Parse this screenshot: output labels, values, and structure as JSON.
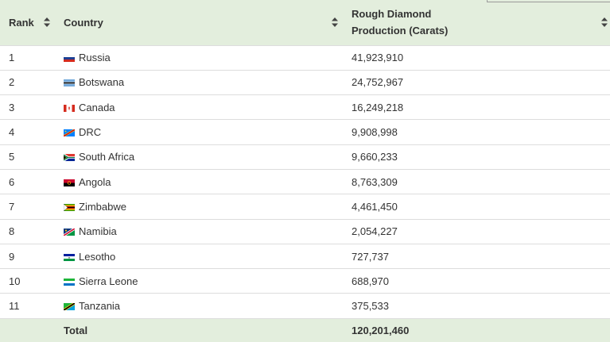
{
  "table": {
    "headers": {
      "rank": "Rank",
      "country": "Country",
      "production_line1": "Rough Diamond",
      "production_line2": "Production (Carats)"
    },
    "rows": [
      {
        "rank": "1",
        "country": "Russia",
        "flag": "russia-flag-icon",
        "production": "41,923,910"
      },
      {
        "rank": "2",
        "country": "Botswana",
        "flag": "botswana-flag-icon",
        "production": "24,752,967"
      },
      {
        "rank": "3",
        "country": "Canada",
        "flag": "canada-flag-icon",
        "production": "16,249,218"
      },
      {
        "rank": "4",
        "country": "DRC",
        "flag": "drc-flag-icon",
        "production": "9,908,998"
      },
      {
        "rank": "5",
        "country": "South Africa",
        "flag": "south-africa-flag-icon",
        "production": "9,660,233"
      },
      {
        "rank": "6",
        "country": "Angola",
        "flag": "angola-flag-icon",
        "production": "8,763,309"
      },
      {
        "rank": "7",
        "country": "Zimbabwe",
        "flag": "zimbabwe-flag-icon",
        "production": "4,461,450"
      },
      {
        "rank": "8",
        "country": "Namibia",
        "flag": "namibia-flag-icon",
        "production": "2,054,227"
      },
      {
        "rank": "9",
        "country": "Lesotho",
        "flag": "lesotho-flag-icon",
        "production": "727,737"
      },
      {
        "rank": "10",
        "country": "Sierra Leone",
        "flag": "sierra-leone-flag-icon",
        "production": "688,970"
      },
      {
        "rank": "11",
        "country": "Tanzania",
        "flag": "tanzania-flag-icon",
        "production": "375,533"
      }
    ],
    "footer": {
      "rank": "",
      "label": "Total",
      "production": "120,201,460"
    }
  },
  "colors": {
    "header_background": "#e3eedd",
    "row_border": "#dddddd",
    "text": "#333333"
  }
}
